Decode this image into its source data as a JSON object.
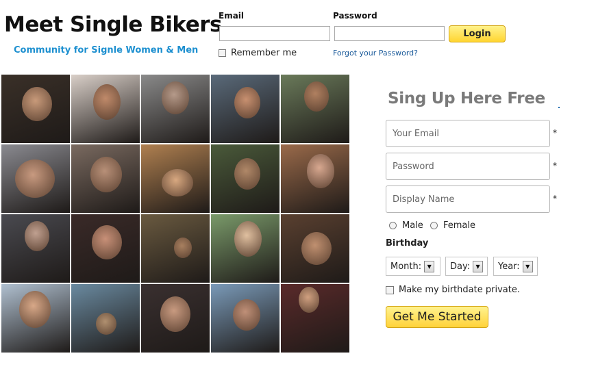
{
  "header": {
    "title": "Meet Single Bikers",
    "tagline": "Community for Signle Women & Men"
  },
  "login": {
    "email_label": "Email",
    "password_label": "Password",
    "email_value": "",
    "password_value": "",
    "login_button": "Login",
    "remember_label": "Remember me",
    "forgot_link": "Forgot your Password?"
  },
  "signup": {
    "title": "Sing Up Here Free",
    "email_placeholder": "Your Email",
    "password_placeholder": "Password",
    "display_name_placeholder": "Display Name",
    "required_mark": "*",
    "male_label": "Male",
    "female_label": "Female",
    "birthday_label": "Birthday",
    "month_label": "Month:",
    "day_label": "Day:",
    "year_label": "Year:",
    "private_label": "Make my birthdate private.",
    "submit_button": "Get Me Started"
  },
  "colors": {
    "accent_blue": "#1e90d0",
    "button_yellow": "#ffd531",
    "title_gray": "#7a7a7a"
  },
  "photos": [
    {
      "bg": "#3a3028",
      "face": "#c89a7a"
    },
    {
      "bg": "#d9cfc8",
      "face": "#c08a6a"
    },
    {
      "bg": "#8a8a8a",
      "face": "#b59a8a"
    },
    {
      "bg": "#5a6a7a",
      "face": "#c89070"
    },
    {
      "bg": "#6a7a5a",
      "face": "#b08060"
    },
    {
      "bg": "#8a8a90",
      "face": "#c89a80"
    },
    {
      "bg": "#7a6a60",
      "face": "#b89078"
    },
    {
      "bg": "#b08050",
      "face": "#d8a880"
    },
    {
      "bg": "#4a5a3a",
      "face": "#b08868"
    },
    {
      "bg": "#9a6a4a",
      "face": "#d8a890"
    },
    {
      "bg": "#4a4a50",
      "face": "#c0a090"
    },
    {
      "bg": "#3a2a28",
      "face": "#c89078"
    },
    {
      "bg": "#6a5a40",
      "face": "#a88060"
    },
    {
      "bg": "#7a9a6a",
      "face": "#e0c0a0"
    },
    {
      "bg": "#5a4030",
      "face": "#c09070"
    },
    {
      "bg": "#b0c0d0",
      "face": "#d8a888"
    },
    {
      "bg": "#6a8aa0",
      "face": "#b09070"
    },
    {
      "bg": "#3a3030",
      "face": "#c89a80"
    },
    {
      "bg": "#7a9ab8",
      "face": "#c09078"
    },
    {
      "bg": "#5a2a2a",
      "face": "#d0a080"
    }
  ]
}
